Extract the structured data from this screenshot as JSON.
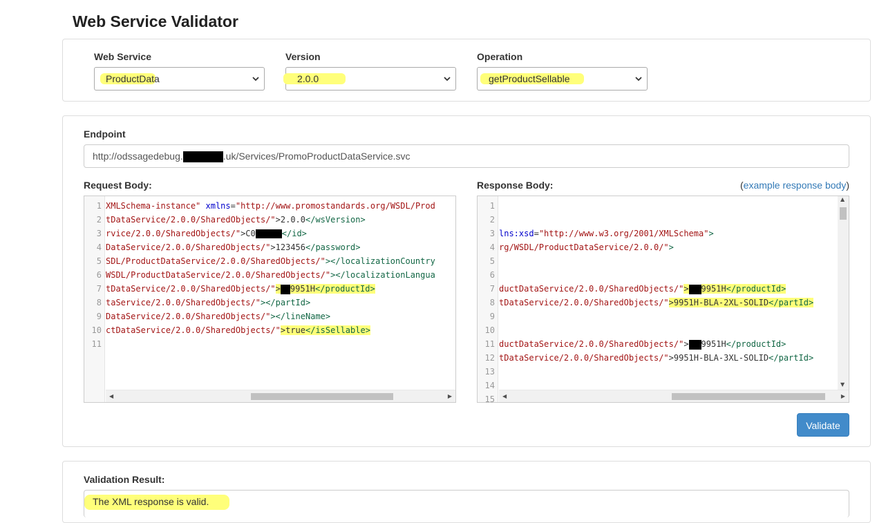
{
  "title": "Web Service Validator",
  "selectors": {
    "web_service": {
      "label": "Web Service",
      "value": "ProductData"
    },
    "version": {
      "label": "Version",
      "value": "2.0.0"
    },
    "operation": {
      "label": "Operation",
      "value": "getProductSellable"
    }
  },
  "endpoint": {
    "label": "Endpoint",
    "prefix": "http://odssagedebug.",
    "suffix": ".uk/Services/PromoProductDataService.svc"
  },
  "request": {
    "label": "Request Body:",
    "line_numbers": [
      "1",
      "2",
      "3",
      "4",
      "5",
      "6",
      "7",
      "8",
      "9",
      "10",
      "11"
    ],
    "lines": {
      "l1": {
        "a": "XMLSchema-instance\" ",
        "b": "xmlns",
        "c": "=",
        "d": "\"http://www.promostandards.org/WSDL/Prod"
      },
      "l2": {
        "a": "tDataService/2.0.0/SharedObjects/\"",
        "b": ">2.0.0",
        "c": "</wsVersion>"
      },
      "l3": {
        "a": "rvice/2.0.0/SharedObjects/\"",
        "b": ">C0",
        "c": "</id>"
      },
      "l4": {
        "a": "DataService/2.0.0/SharedObjects/\"",
        "b": ">123456",
        "c": "</password>"
      },
      "l5": {
        "a": "SDL/ProductDataService/2.0.0/SharedObjects/\"",
        "b": "></localizationCountry"
      },
      "l6": {
        "a": "WSDL/ProductDataService/2.0.0/SharedObjects/\"",
        "b": "></localizationLangua"
      },
      "l7": {
        "a": "tDataService/2.0.0/SharedObjects/\"",
        "b": ">",
        "c": "9951H",
        "d": "</productId>"
      },
      "l8": {
        "a": "taService/2.0.0/SharedObjects/\"",
        "b": "></partId>"
      },
      "l9": {
        "a": "DataService/2.0.0/SharedObjects/\"",
        "b": "></lineName>"
      },
      "l10": {
        "a": "ctDataService/2.0.0/SharedObjects/\"",
        "b": ">true",
        "c": "</isSellable>"
      }
    }
  },
  "response": {
    "label": "Response Body:",
    "example_open": "(",
    "example_link": "example response body",
    "example_close": ")",
    "line_numbers": [
      "1",
      "2",
      "3",
      "4",
      "5",
      "6",
      "7",
      "8",
      "9",
      "10",
      "11",
      "12",
      "13",
      "14",
      "15"
    ],
    "lines": {
      "l3": {
        "a": "lns:xsd",
        "b": "=",
        "c": "\"http://www.w3.org/2001/XMLSchema\"",
        "d": ">"
      },
      "l4": {
        "a": "rg/WSDL/ProductDataService/2.0.0/\"",
        "b": ">"
      },
      "l7": {
        "a": "ductDataService/2.0.0/SharedObjects/\"",
        "b": ">",
        "c": "9951H",
        "d": "</productId>"
      },
      "l8": {
        "a": "tDataService/2.0.0/SharedObjects/\"",
        "b": ">9951H-BLA-2XL-SOLID",
        "c": "</partId>"
      },
      "l11": {
        "a": "ductDataService/2.0.0/SharedObjects/\"",
        "b": ">",
        "c": "9951H",
        "d": "</productId>"
      },
      "l12": {
        "a": "tDataService/2.0.0/SharedObjects/\"",
        "b": ">9951H-BLA-3XL-SOLID",
        "c": "</partId>"
      }
    }
  },
  "validate_button": "Validate",
  "result": {
    "label": "Validation Result:",
    "text": "The XML response is valid."
  },
  "colors": {
    "accent": "#428bca",
    "highlight": "#ffff7a",
    "link": "#337ab7",
    "string": "#a31515",
    "tag": "#116644",
    "attribute": "#0000cc"
  }
}
